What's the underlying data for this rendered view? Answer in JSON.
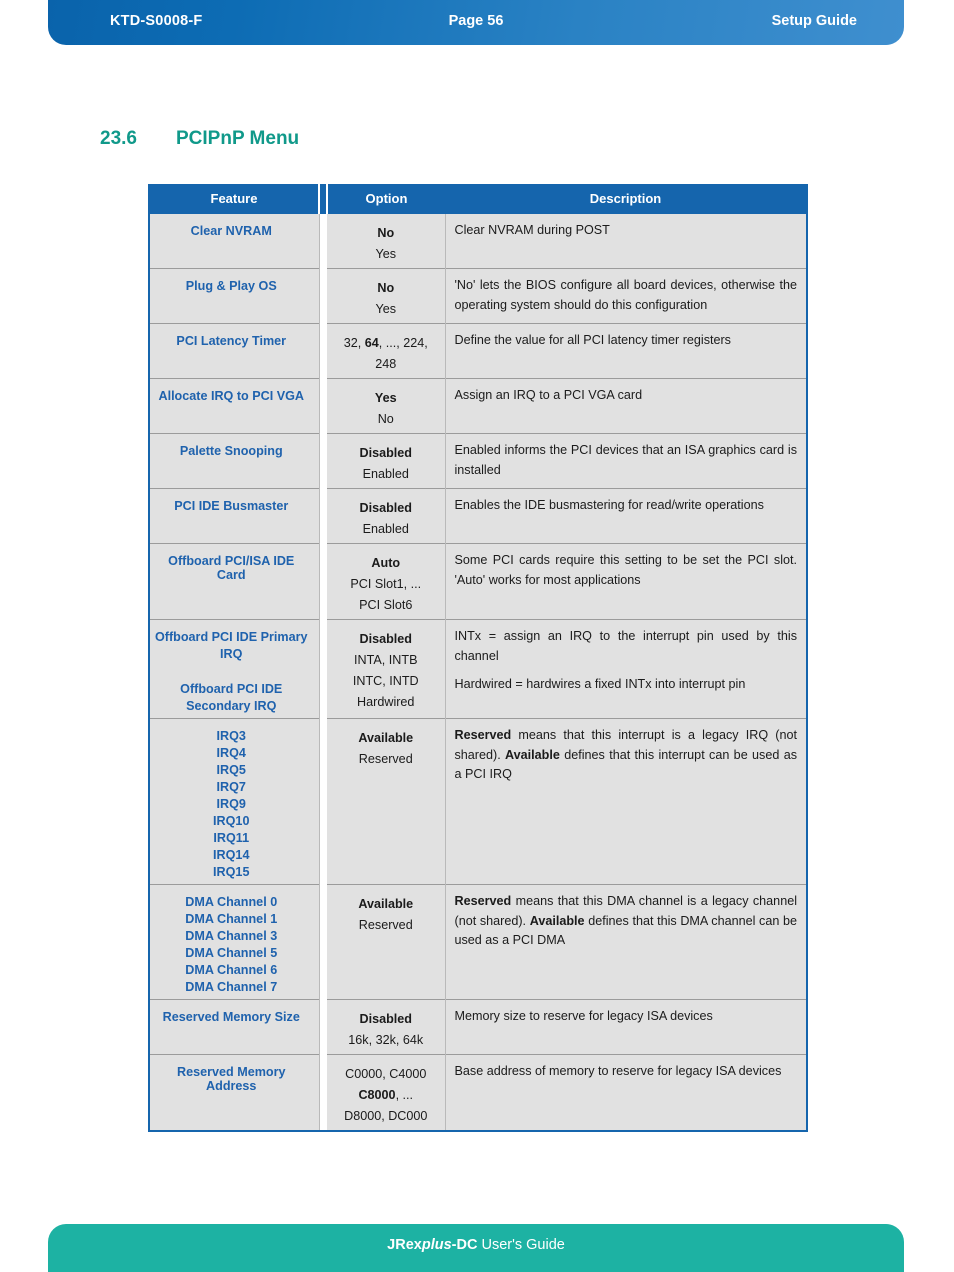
{
  "header": {
    "doc_id": "KTD-S0008-F",
    "page_label": "Page 56",
    "guide_label": "Setup Guide"
  },
  "section": {
    "number": "23.6",
    "title": "PCIPnP Menu"
  },
  "table": {
    "columns": [
      "Feature",
      "Option",
      "Description"
    ],
    "rows": [
      {
        "feature_lines": [
          "Clear NVRAM"
        ],
        "option_lines": [
          {
            "text": "No",
            "default": true
          },
          {
            "text": "Yes",
            "default": false
          }
        ],
        "description": "Clear NVRAM during POST"
      },
      {
        "feature_lines": [
          "Plug & Play OS"
        ],
        "option_lines": [
          {
            "text": "No",
            "default": true
          },
          {
            "text": "Yes",
            "default": false
          }
        ],
        "description": "'No' lets the BIOS configure all board devices, otherwise the operating system should do this configuration"
      },
      {
        "feature_lines": [
          "PCI Latency Timer"
        ],
        "option_lines": [
          {
            "text": "32, 64, ..., 224,",
            "default": false,
            "html": "32, <b>64</b>, ..., 224,"
          },
          {
            "text": "248",
            "default": false
          }
        ],
        "description": "Define the value for all PCI latency timer registers"
      },
      {
        "feature_lines": [
          "Allocate IRQ to PCI VGA"
        ],
        "option_lines": [
          {
            "text": "Yes",
            "default": true
          },
          {
            "text": "No",
            "default": false
          }
        ],
        "description": "Assign an IRQ to a PCI VGA card"
      },
      {
        "feature_lines": [
          "Palette Snooping"
        ],
        "option_lines": [
          {
            "text": "Disabled",
            "default": true
          },
          {
            "text": "Enabled",
            "default": false
          }
        ],
        "description": "Enabled informs the PCI devices that an ISA graphics card is installed"
      },
      {
        "feature_lines": [
          "PCI IDE Busmaster"
        ],
        "option_lines": [
          {
            "text": "Disabled",
            "default": true
          },
          {
            "text": "Enabled",
            "default": false
          }
        ],
        "description": "Enables the IDE busmastering for read/write operations"
      },
      {
        "feature_lines": [
          "Offboard PCI/ISA IDE Card"
        ],
        "option_lines": [
          {
            "text": "Auto",
            "default": true
          },
          {
            "text": "PCI Slot1, ...",
            "default": false
          },
          {
            "text": "PCI Slot6",
            "default": false
          }
        ],
        "description": "Some PCI cards require this setting to be set the PCI slot. 'Auto' works for most applications"
      },
      {
        "feature_lines": [
          "Offboard PCI IDE Primary",
          "IRQ",
          "",
          "Offboard PCI IDE",
          "Secondary IRQ"
        ],
        "option_lines": [
          {
            "text": "Disabled",
            "default": true
          },
          {
            "text": "INTA, INTB",
            "default": false
          },
          {
            "text": "INTC, INTD",
            "default": false
          },
          {
            "text": "Hardwired",
            "default": false
          }
        ],
        "description_paragraphs": [
          "INTx = assign an IRQ to the interrupt pin used by this channel",
          "Hardwired = hardwires a fixed INTx into interrupt pin"
        ]
      },
      {
        "feature_lines": [
          "IRQ3",
          "IRQ4",
          "IRQ5",
          "IRQ7",
          "IRQ9",
          "IRQ10",
          "IRQ11",
          "IRQ14",
          "IRQ15"
        ],
        "option_lines": [
          {
            "text": "Available",
            "default": true
          },
          {
            "text": "Reserved",
            "default": false
          }
        ],
        "description_html": "<b>Reserved</b> means that this interrupt is a legacy IRQ (not shared). <b>Available</b> defines that this interrupt can be used as a PCI IRQ"
      },
      {
        "feature_lines": [
          "DMA Channel 0",
          "DMA Channel 1",
          "DMA Channel 3",
          "DMA Channel 5",
          "DMA Channel 6",
          "DMA Channel 7"
        ],
        "option_lines": [
          {
            "text": "Available",
            "default": true
          },
          {
            "text": "Reserved",
            "default": false
          }
        ],
        "description_html": "<b>Reserved</b> means that this DMA channel is a legacy channel (not shared). <b>Available</b> defines that this DMA channel can be used as a PCI DMA"
      },
      {
        "feature_lines": [
          "Reserved Memory Size"
        ],
        "option_lines": [
          {
            "text": "Disabled",
            "default": true
          },
          {
            "text": "16k, 32k, 64k",
            "default": false
          }
        ],
        "description": "Memory size to reserve for legacy ISA devices"
      },
      {
        "feature_lines": [
          "Reserved Memory Address"
        ],
        "option_lines": [
          {
            "text": "C0000, C4000",
            "default": false
          },
          {
            "text": "C8000, ...",
            "default": false,
            "html": "<b>C8000</b>, ..."
          },
          {
            "text": "D8000, DC000",
            "default": false
          }
        ],
        "description": "Base address of memory to reserve for legacy ISA devices"
      }
    ]
  },
  "footer": {
    "brand_1": "JRex",
    "brand_2": "plus",
    "brand_3": "-DC",
    "brand_4": " User's Guide"
  },
  "colors": {
    "header_blue": "#1565ad",
    "footer_teal": "#1db2a3",
    "heading_teal": "#10998a",
    "feature_blue": "#1f62ad",
    "row_bg": "#e1e1e1"
  }
}
